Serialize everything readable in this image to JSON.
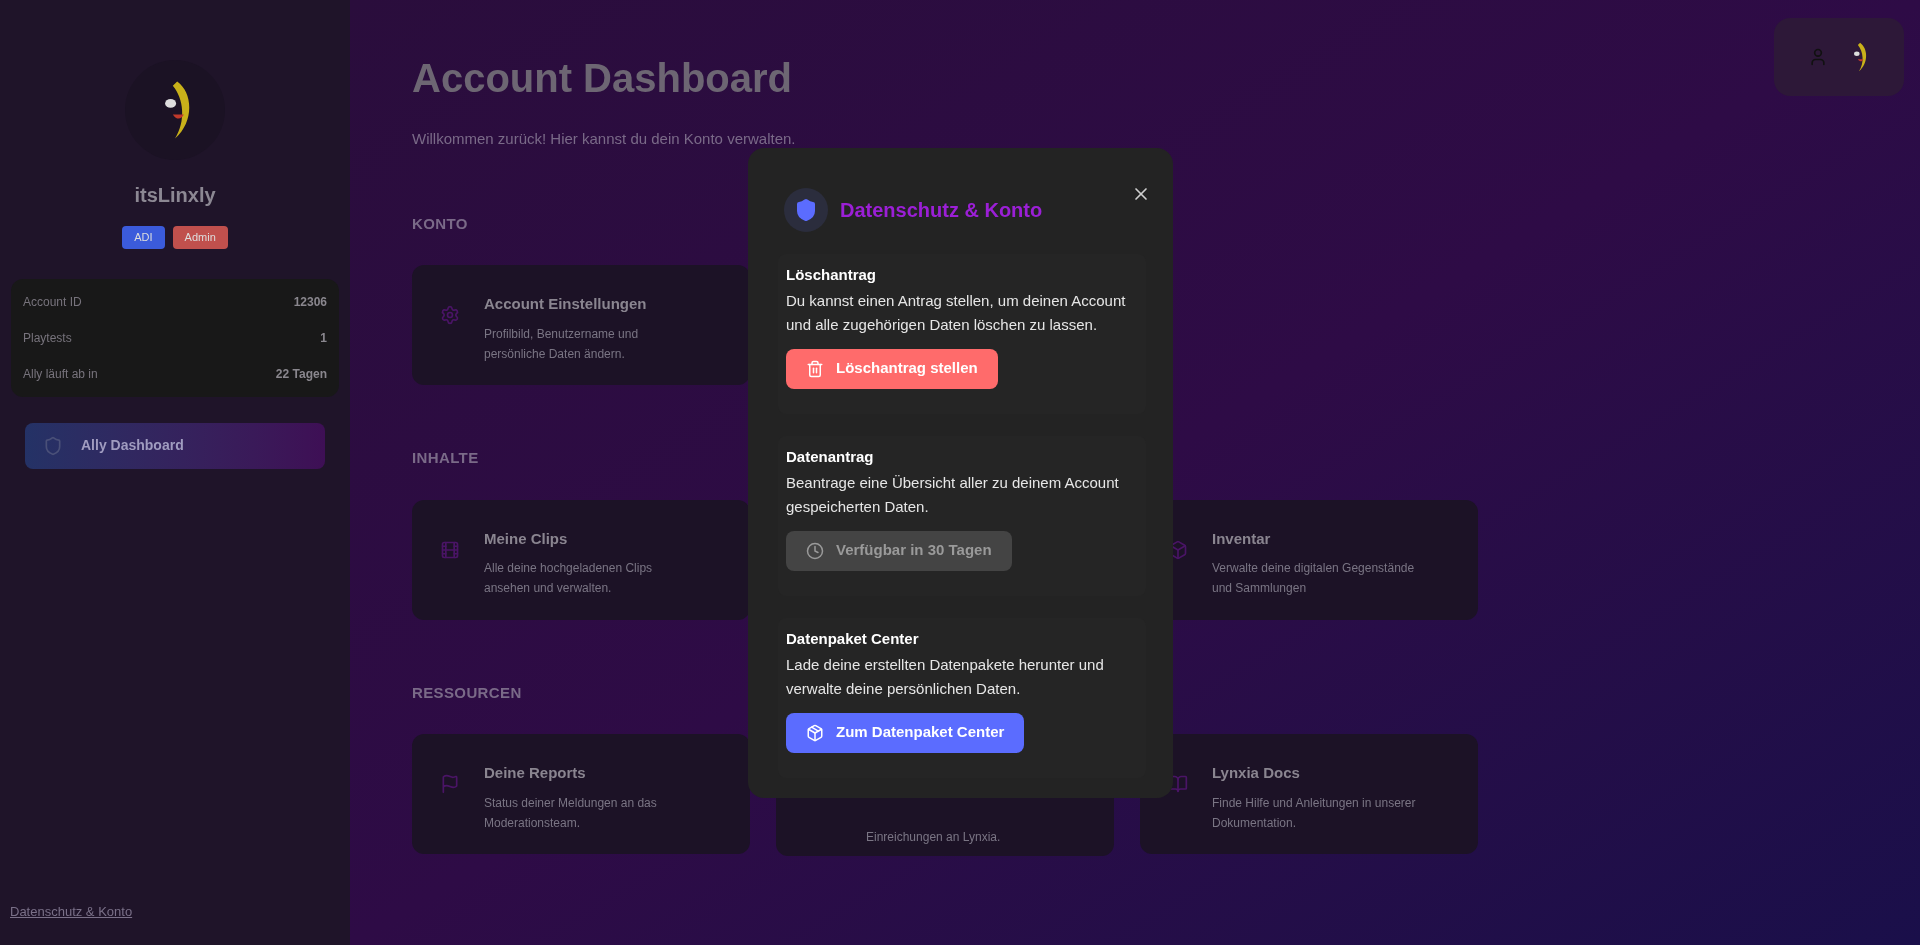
{
  "sidebar": {
    "username": "itsLinxly",
    "badges": [
      {
        "label": "ADI",
        "color": "#3b5bdb"
      },
      {
        "label": "Admin",
        "color": "#c0504d"
      }
    ],
    "stats": [
      {
        "label": "Account ID",
        "value": "12306"
      },
      {
        "label": "Playtests",
        "value": "1"
      },
      {
        "label": "Ally läuft ab in",
        "value": "22 Tagen"
      }
    ],
    "nav_button": "Ally Dashboard",
    "footer_link": "Datenschutz & Konto"
  },
  "header": {
    "title": "Account Dashboard",
    "subtitle": "Willkommen zurück! Hier kannst du dein Konto verwalten."
  },
  "sections": [
    {
      "heading": "KONTO",
      "cards": [
        {
          "kind": "card",
          "title": "Account Einstellungen",
          "description": "Profilbild, Benutzername und persönliche Daten ändern."
        }
      ]
    },
    {
      "heading": "INHALTE",
      "cards": [
        {
          "kind": "card",
          "title": "Meine Clips",
          "description": "Alle deine hochgeladenen Clips ansehen und verwalten."
        },
        {
          "kind": "covered"
        },
        {
          "kind": "card",
          "title": "Inventar",
          "description": "Verwalte deine digitalen Gegenstände und Sammlungen"
        }
      ]
    },
    {
      "heading": "RESSOURCEN",
      "cards": [
        {
          "kind": "card",
          "title": "Deine Reports",
          "description": "Status deiner Meldungen an das Moderationsteam."
        },
        {
          "kind": "partial",
          "description": "Einreichungen an Lynxia."
        },
        {
          "kind": "card",
          "title": "Lynxia Docs",
          "description": "Finde Hilfe und Anleitungen in unserer Dokumentation."
        }
      ]
    }
  ],
  "modal": {
    "title": "Datenschutz & Konto",
    "sections": [
      {
        "heading": "Löschantrag",
        "text": "Du kannst einen Antrag stellen, um deinen Account und alle zugehörigen Daten löschen zu lassen.",
        "button": {
          "kind": "danger",
          "label": "Löschantrag stellen"
        }
      },
      {
        "heading": "Datenantrag",
        "text": "Beantrage eine Übersicht aller zu deinem Account gespeicherten Daten.",
        "button": {
          "kind": "disabled",
          "label": "Verfügbar in 30 Tagen"
        }
      },
      {
        "heading": "Datenpaket Center",
        "text": "Lade deine erstellten Datenpakete herunter und verwalte deine persönlichen Daten.",
        "button": {
          "kind": "primary",
          "label": "Zum Datenpaket Center"
        }
      }
    ]
  }
}
